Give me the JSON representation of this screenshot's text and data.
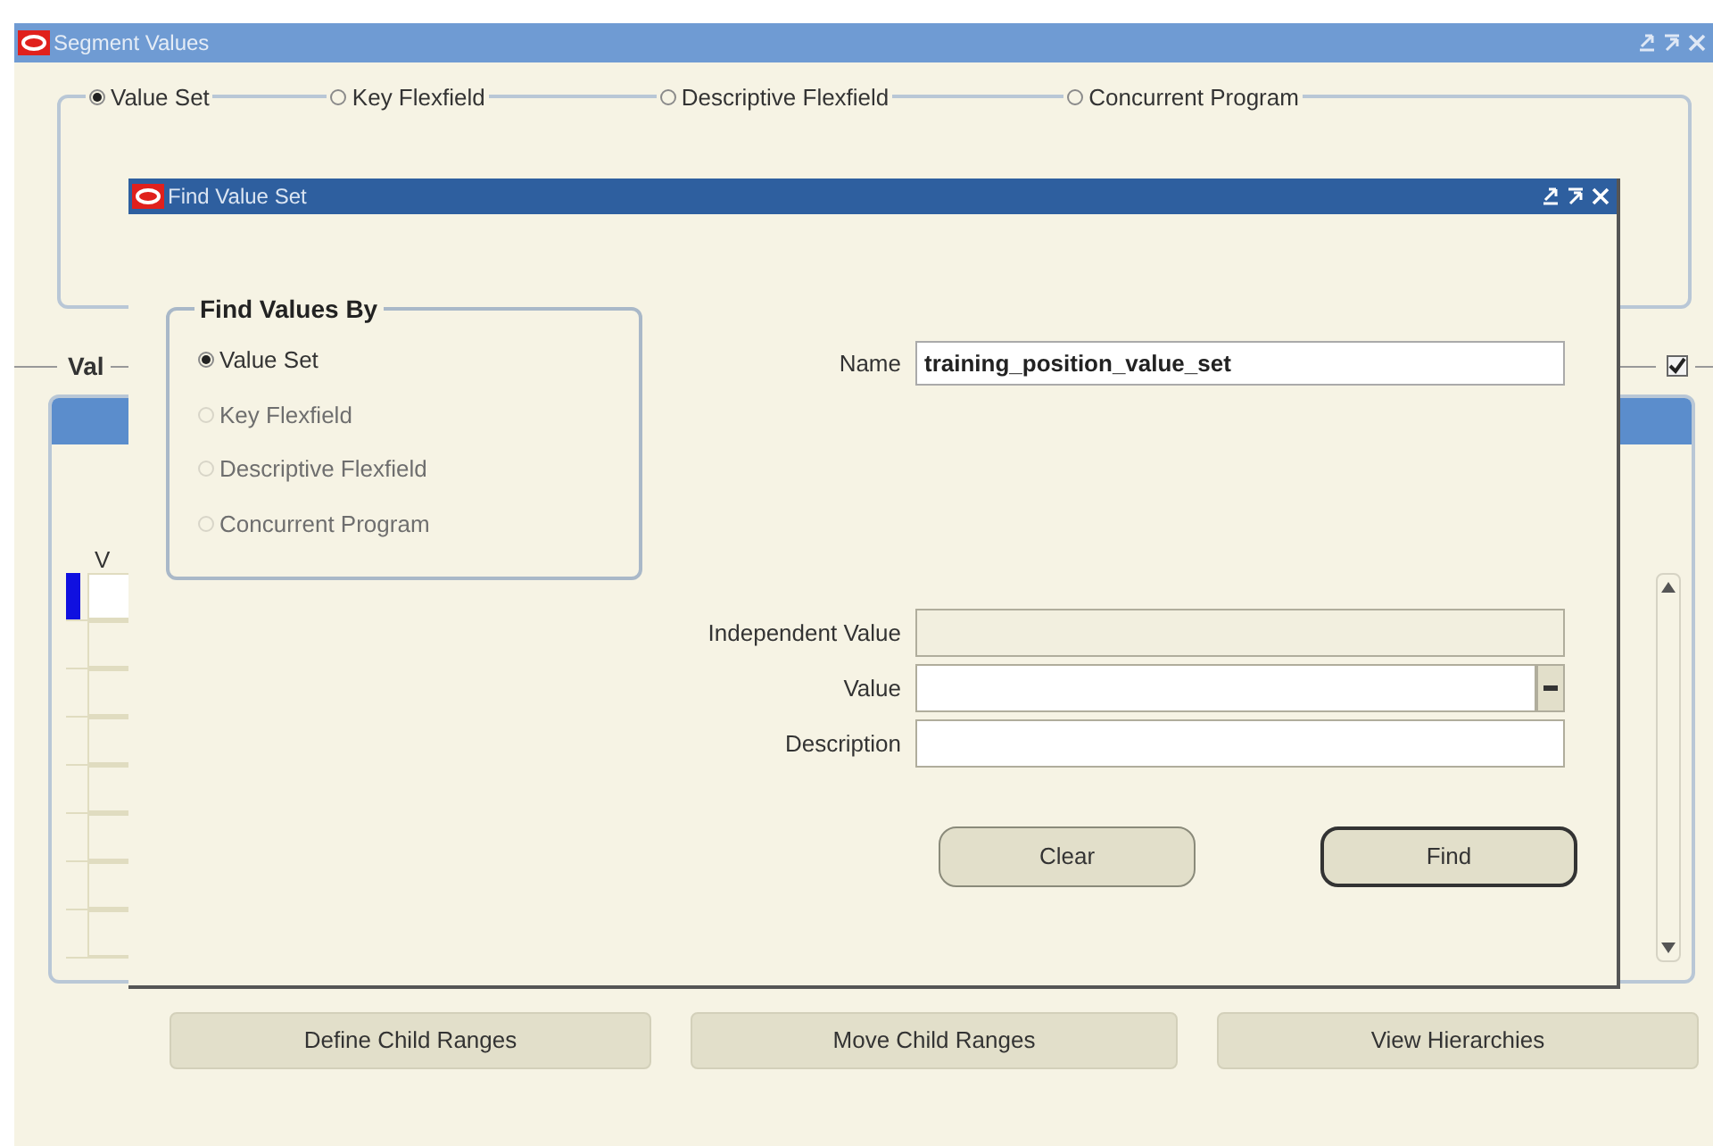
{
  "window": {
    "title": "Segment Values"
  },
  "source_options": [
    {
      "label": "Value Set",
      "selected": true
    },
    {
      "label": "Key Flexfield",
      "selected": false
    },
    {
      "label": "Descriptive Flexfield",
      "selected": false
    },
    {
      "label": "Concurrent Program",
      "selected": false
    }
  ],
  "values_section": {
    "title": "Val",
    "checked": true,
    "column_1": "V",
    "rows": [
      {
        "current": true
      },
      {
        "current": false
      },
      {
        "current": false
      },
      {
        "current": false
      },
      {
        "current": false
      },
      {
        "current": false
      },
      {
        "current": false
      },
      {
        "current": false
      }
    ]
  },
  "buttons": [
    "Define Child Ranges",
    "Move Child Ranges",
    "View Hierarchies"
  ],
  "dialog": {
    "title": "Find Value Set",
    "group_title": "Find Values By",
    "options": [
      {
        "label": "Value Set",
        "selected": true,
        "disabled": false
      },
      {
        "label": "Key Flexfield",
        "selected": false,
        "disabled": true
      },
      {
        "label": "Descriptive Flexfield",
        "selected": false,
        "disabled": true
      },
      {
        "label": "Concurrent Program",
        "selected": false,
        "disabled": true
      }
    ],
    "name_label": "Name",
    "name_value": "training_position_value_set",
    "fields": [
      {
        "label": "Independent Value",
        "disabled": true,
        "lov": false
      },
      {
        "label": "Value",
        "disabled": false,
        "lov": true
      },
      {
        "label": "Description",
        "disabled": false,
        "lov": false
      }
    ],
    "actions": [
      {
        "label": "Clear",
        "default": false
      },
      {
        "label": "Find",
        "default": true
      }
    ]
  }
}
